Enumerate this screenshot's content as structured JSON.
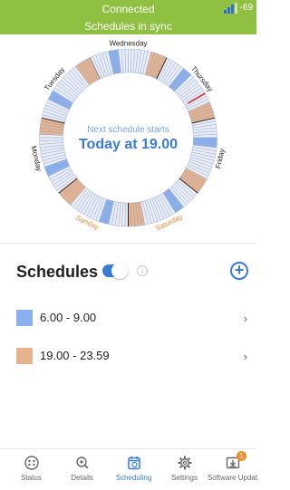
{
  "status_bar": {
    "title": "Connected",
    "subtitle": "Schedules in sync",
    "rssi": "-69"
  },
  "dial": {
    "days": [
      "Wednesday",
      "Thursday",
      "Friday",
      "Saturday",
      "Sunday",
      "Monday",
      "Tuesday"
    ],
    "caption": "Next schedule starts",
    "value": "Today at 19.00"
  },
  "schedules": {
    "heading": "Schedules",
    "toggle_on": true,
    "items": [
      {
        "label": "6.00 - 9.00",
        "color": "#8ab0ee"
      },
      {
        "label": "19.00 - 23.59",
        "color": "#e6b38f"
      }
    ]
  },
  "nav": {
    "items": [
      {
        "label": "Status",
        "icon": "status-icon"
      },
      {
        "label": "Details",
        "icon": "magnify-plus-icon"
      },
      {
        "label": "Scheduling",
        "icon": "calendar-clock-icon",
        "active": true
      },
      {
        "label": "Settings",
        "icon": "gear-icon"
      },
      {
        "label": "Software Updat",
        "icon": "software-update-icon",
        "badge": "1"
      }
    ]
  },
  "colors": {
    "green": "#8fc041",
    "blue": "#3a7bd5",
    "orange": "#e6b38f"
  }
}
